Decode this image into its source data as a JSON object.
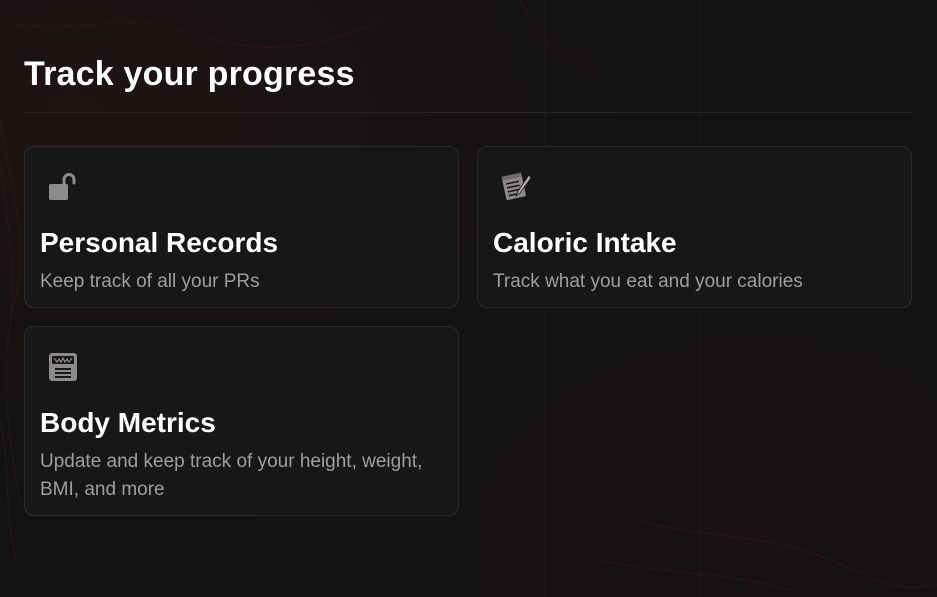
{
  "page": {
    "title": "Track your progress"
  },
  "cards": [
    {
      "id": "personal-records",
      "icon": "unlocked-padlock-icon",
      "title": "Personal Records",
      "description": "Keep track of all your PRs"
    },
    {
      "id": "caloric-intake",
      "icon": "notepad-pencil-icon",
      "title": "Caloric Intake",
      "description": "Track what you eat and your calories"
    },
    {
      "id": "body-metrics",
      "icon": "weighing-scale-icon",
      "title": "Body Metrics",
      "description": "Update and keep track of your height, weight, BMI, and more"
    }
  ],
  "colors": {
    "background": "#131212",
    "card_background": "#181717",
    "card_border": "#2c2a2a",
    "title_text": "#ffffff",
    "description_text": "#a19d9d",
    "icon": "#8e8a8a"
  }
}
